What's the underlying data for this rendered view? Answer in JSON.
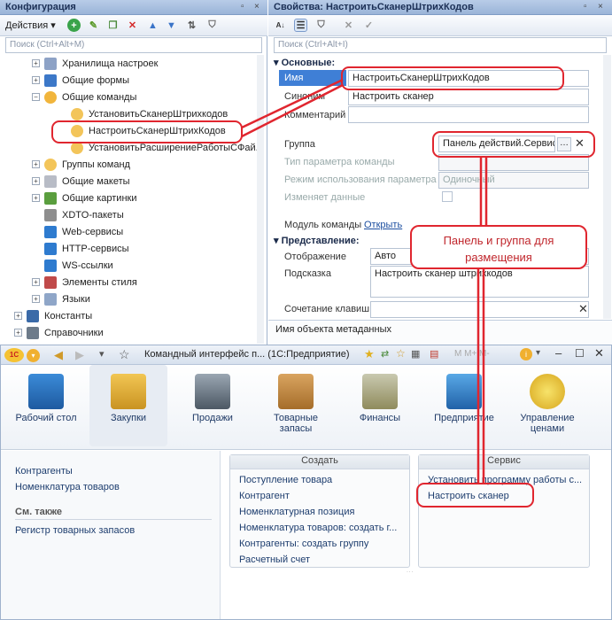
{
  "config_panel": {
    "title": "Конфигурация",
    "actions_label": "Действия",
    "search_placeholder": "Поиск (Ctrl+Alt+M)",
    "tree": [
      {
        "label": "Хранилища настроек",
        "expander": "+"
      },
      {
        "label": "Общие формы",
        "expander": "+"
      },
      {
        "label": "Общие команды",
        "expander": "−"
      },
      {
        "label": "УстановитьСканерШтрихкодов",
        "expander": ""
      },
      {
        "label": "НастроитьСканерШтрихКодов",
        "expander": ""
      },
      {
        "label": "УстановитьРасширениеРаботыСФай...",
        "expander": ""
      },
      {
        "label": "Группы команд",
        "expander": "+"
      },
      {
        "label": "Общие макеты",
        "expander": "+"
      },
      {
        "label": "Общие картинки",
        "expander": "+"
      },
      {
        "label": "XDTO-пакеты",
        "expander": ""
      },
      {
        "label": "Web-сервисы",
        "expander": ""
      },
      {
        "label": "HTTP-сервисы",
        "expander": ""
      },
      {
        "label": "WS-ссылки",
        "expander": ""
      },
      {
        "label": "Элементы стиля",
        "expander": "+"
      },
      {
        "label": "Языки",
        "expander": "+"
      },
      {
        "label": "Константы",
        "expander": "+"
      },
      {
        "label": "Справочники",
        "expander": "+"
      }
    ]
  },
  "props_panel": {
    "title": "Свойства: НастроитьСканерШтрихКодов",
    "search_placeholder": "Поиск (Ctrl+Alt+I)",
    "section_main": "Основные:",
    "section_view": "Представление:",
    "name_label": "Имя",
    "name_value": "НастроитьСканерШтрихКодов",
    "synonym_label": "Синоним",
    "synonym_value": "Настроить сканер",
    "comment_label": "Комментарий",
    "group_label": "Группа",
    "group_value": "Панель действий.Сервис",
    "param_type_label": "Тип параметра команды",
    "param_mode_label": "Режим использования параметра",
    "param_mode_value": "Одиночный",
    "changes_data_label": "Изменяет данные",
    "module_label": "Модуль команды",
    "module_link": "Открыть",
    "display_label": "Отображение",
    "display_value": "Авто",
    "tooltip_label": "Подсказка",
    "tooltip_value": "Настроить сканер штрихкодов",
    "shortcut_label": "Сочетание клавиш",
    "status_text": "Имя объекта метаданных"
  },
  "callout": {
    "text": "Панель и группа для размещения"
  },
  "app_window": {
    "title": "Командный интерфейс п...  (1С:Предприятие)",
    "logo": "1С",
    "nav": [
      {
        "label": "Рабочий стол"
      },
      {
        "label": "Закупки"
      },
      {
        "label": "Продажи"
      },
      {
        "label": "Товарные запасы"
      },
      {
        "label": "Финансы"
      },
      {
        "label": "Предприятие"
      },
      {
        "label": "Управление ценами"
      }
    ],
    "side_links": [
      "Контрагенты",
      "Номенклатура товаров"
    ],
    "see_also_title": "См. также",
    "see_also_links": [
      "Регистр товарных запасов"
    ],
    "create_panel": {
      "title": "Создать",
      "items": [
        "Поступление товара",
        "Контрагент",
        "Номенклатурная позиция",
        "Номенклатура товаров: создать г...",
        "Контрагенты: создать группу",
        "Расчетный счет"
      ]
    },
    "service_panel": {
      "title": "Сервис",
      "items": [
        "Установить программу работы с...",
        "Настроить сканер"
      ]
    }
  },
  "colors": {
    "accent_red": "#e0262f",
    "selection_blue": "#3f7fd6",
    "link_blue": "#1d3d6e"
  }
}
